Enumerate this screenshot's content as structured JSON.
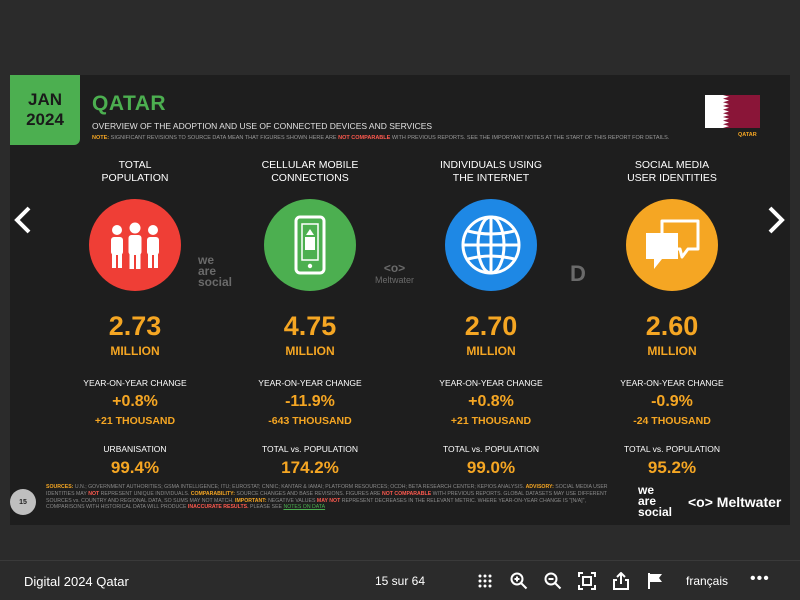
{
  "slide": {
    "date": {
      "month": "JAN",
      "year": "2024"
    },
    "country": "QATAR",
    "subtitle": "OVERVIEW OF THE ADOPTION AND USE OF CONNECTED DEVICES AND SERVICES",
    "note": {
      "label": "NOTE:",
      "text_before": "SIGNIFICANT REVISIONS TO SOURCE DATA MEAN THAT FIGURES SHOWN HERE ARE",
      "emphasis": "NOT COMPARABLE",
      "text_after": "WITH PREVIOUS REPORTS. SEE THE IMPORTANT NOTES AT THE START OF THIS REPORT FOR DETAILS."
    },
    "flag_label": "QATAR",
    "colors": {
      "accent_green": "#4caf50",
      "orange": "#f5a623",
      "red": "#ef3e36",
      "blue": "#1e88e5",
      "flag_maroon": "#8a1538"
    },
    "stats": [
      {
        "heading": "TOTAL\nPOPULATION",
        "icon": "people-icon",
        "value": "2.73",
        "unit": "MILLION",
        "yoy_label": "YEAR-ON-YEAR CHANGE",
        "yoy_pct": "+0.8%",
        "yoy_abs": "+21 THOUSAND",
        "extra_label": "URBANISATION",
        "extra_value": "99.4%"
      },
      {
        "heading": "CELLULAR MOBILE\nCONNECTIONS",
        "icon": "mobile-phone-icon",
        "value": "4.75",
        "unit": "MILLION",
        "yoy_label": "YEAR-ON-YEAR CHANGE",
        "yoy_pct": "-11.9%",
        "yoy_abs": "-643 THOUSAND",
        "extra_label": "TOTAL vs. POPULATION",
        "extra_value": "174.2%"
      },
      {
        "heading": "INDIVIDUALS USING\nTHE INTERNET",
        "icon": "globe-icon",
        "value": "2.70",
        "unit": "MILLION",
        "yoy_label": "YEAR-ON-YEAR CHANGE",
        "yoy_pct": "+0.8%",
        "yoy_abs": "+21 THOUSAND",
        "extra_label": "TOTAL vs. POPULATION",
        "extra_value": "99.0%"
      },
      {
        "heading": "SOCIAL MEDIA\nUSER IDENTITIES",
        "icon": "chat-bubbles-icon",
        "value": "2.60",
        "unit": "MILLION",
        "yoy_label": "YEAR-ON-YEAR CHANGE",
        "yoy_pct": "-0.9%",
        "yoy_abs": "-24 THOUSAND",
        "extra_label": "TOTAL vs. POPULATION",
        "extra_value": "95.2%"
      }
    ],
    "watermarks": {
      "we_are_social": [
        "we",
        "are",
        "social"
      ],
      "meltwater": "Meltwater"
    },
    "page_number": "15",
    "sources": {
      "label": "SOURCES:",
      "text": "U.N.; GOVERNMENT AUTHORITIES; GSMA INTELLIGENCE; ITU; EUROSTAT; CNNIC; KANTAR & IAMAI; PLATFORM RESOURCES; OCDH; BETA RESEARCH CENTER; KEPIOS ANALYSIS.",
      "advisory_label": "ADVISORY:",
      "advisory_text": "SOCIAL MEDIA USER IDENTITIES MAY",
      "advisory_red": "NOT",
      "advisory_rest": "REPRESENT UNIQUE INDIVIDUALS.",
      "comparability_label": "COMPARABILITY:",
      "comparability_text": "SOURCE CHANGES AND BASE REVISIONS. FIGURES ARE",
      "comparability_red": "NOT COMPARABLE",
      "comparability_rest": "WITH PREVIOUS REPORTS. GLOBAL DATASETS MAY USE DIFFERENT SOURCES vs. COUNTRY AND REGIONAL DATA, SO SUMS MAY NOT MATCH.",
      "important_label": "IMPORTANT:",
      "important_text": "NEGATIVE VALUES",
      "important_red": "MAY NOT",
      "important_rest": "REPRESENT DECREASES IN THE RELEVANT METRIC. WHERE YEAR-ON-YEAR CHANGE IS \"[N/A]\", COMPARISONS WITH HISTORICAL DATA WILL PRODUCE",
      "inaccurate": "INACCURATE RESULTS.",
      "see": "PLEASE SEE",
      "notes_link": "NOTES ON DATA"
    },
    "footer_logos": {
      "we_are_social": [
        "we",
        "are",
        "social"
      ],
      "meltwater": "Meltwater"
    }
  },
  "viewer": {
    "doc_title": "Digital 2024 Qatar",
    "page_indicator": "15 sur 64",
    "language": "français",
    "more": "•••",
    "toolbar_icons": [
      "grid-view-icon",
      "zoom-in-icon",
      "zoom-out-icon",
      "fullscreen-icon",
      "share-icon",
      "flag-icon"
    ]
  }
}
